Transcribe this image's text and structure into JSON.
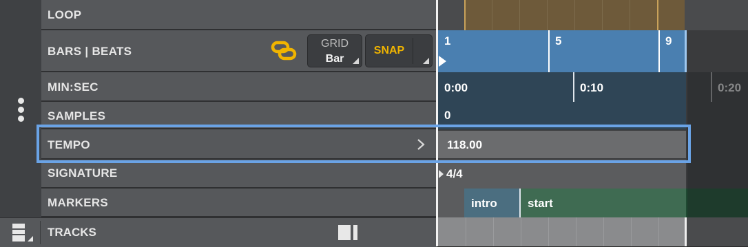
{
  "header": {
    "loop_label": "LOOP",
    "bars_beats_label": "BARS | BEATS",
    "grid": {
      "title": "GRID",
      "value": "Bar"
    },
    "snap_label": "SNAP",
    "minsec_label": "MIN:SEC",
    "samples_label": "SAMPLES",
    "tempo_label": "TEMPO",
    "signature_label": "SIGNATURE",
    "markers_label": "MARKERS",
    "tracks_label": "TRACKS"
  },
  "timeline": {
    "bars": [
      "1",
      "5",
      "9"
    ],
    "minsec": [
      "0:00",
      "0:10",
      "0:20"
    ],
    "samples_start": "0",
    "tempo_value": "118.00",
    "signature_value": "4/4",
    "markers": [
      {
        "label": "intro"
      },
      {
        "label": "start"
      }
    ]
  },
  "colors": {
    "accent_link": "#f0b400",
    "snap_text": "#f0b400",
    "highlight": "#6aa3e6",
    "loop_region": "#6e5a3a",
    "bars_ruler": "#4a7fb0",
    "intro_marker": "#4b6e80",
    "start_marker": "#3f6b52"
  },
  "icons": {
    "link": "chain-link-icon",
    "more": "vertical-dots-icon",
    "expand": "chevron-right-icon",
    "track_list": "track-list-icon",
    "split_view": "split-view-icon"
  }
}
